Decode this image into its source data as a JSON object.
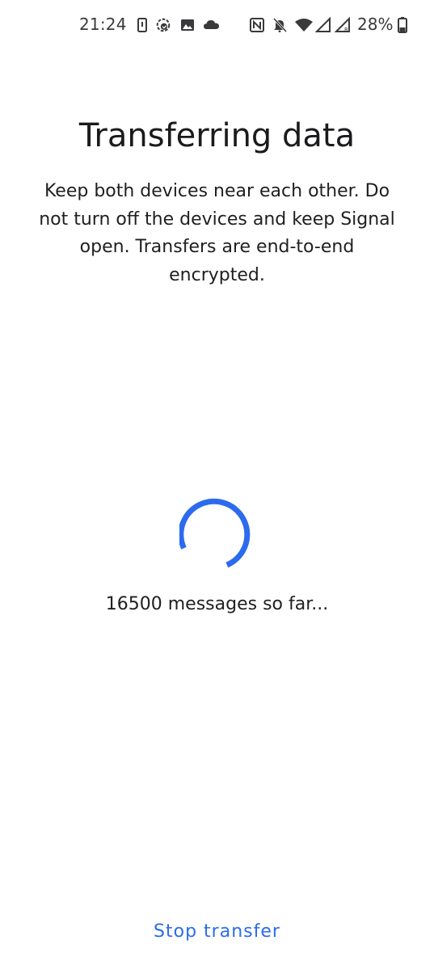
{
  "status_bar": {
    "time": "21:24",
    "battery_percent": "28%",
    "icons": [
      "sim-status-icon",
      "sync-icon",
      "image-icon",
      "cloud-icon",
      "nfc-icon",
      "notifications-off-icon",
      "wifi-icon",
      "signal-icon",
      "signal-roaming-icon",
      "battery-icon"
    ]
  },
  "screen": {
    "title": "Transferring data",
    "description": "Keep both devices near each other. Do not turn off the devices and keep Signal open. Transfers are end-to-end encrypted.",
    "progress_text": "16500 messages so far...",
    "stop_button_label": "Stop transfer"
  },
  "colors": {
    "accent": "#2c6bed",
    "text": "#1b1b1d",
    "background": "#ffffff"
  }
}
